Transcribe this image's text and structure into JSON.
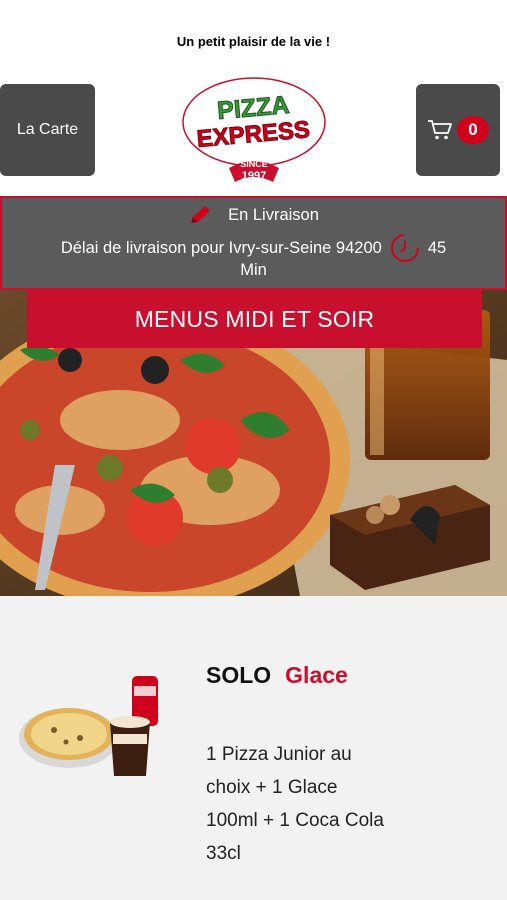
{
  "header": {
    "tagline": "Un petit plaisir de la vie !",
    "carte_label": "La Carte",
    "cart_count": "0",
    "logo": {
      "line1": "PIZZA",
      "line2": "EXPRESS",
      "since": "SINCE",
      "year": "1997"
    }
  },
  "delivery": {
    "status": "En Livraison",
    "delay_text": "Délai de livraison pour Ivry-sur-Seine 94200",
    "minutes": "45",
    "unit": "Min"
  },
  "banner": {
    "title": "MENUS MIDI ET SOIR"
  },
  "menu_item": {
    "name": "SOLO",
    "variant": "Glace",
    "description": "1 Pizza Junior au choix  + 1 Glace 100ml  + 1 Coca Cola 33cl"
  },
  "colors": {
    "accent": "#c8102e",
    "dark_button": "#4a4a4a",
    "band": "#5b5b5b"
  },
  "icons": [
    "cart-icon",
    "pencil-icon",
    "clock-icon"
  ]
}
